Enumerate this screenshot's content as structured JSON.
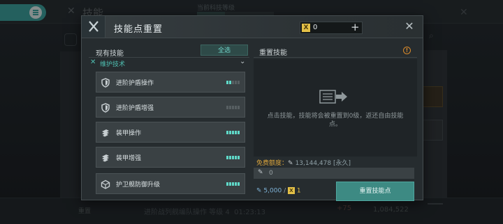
{
  "background": {
    "title": "技能",
    "tech_label": "当前科技等级",
    "bottom_reset": "重置",
    "bottom_text": "进阶战列舰编队操作 等级 4",
    "bottom_timer": "01:23:13",
    "bottom_plus": "+75",
    "bottom_num": "1,084,522"
  },
  "modal": {
    "title": "技能点重置",
    "currency_value": "0",
    "currency_icon": "X",
    "left": {
      "title": "现有技能",
      "all_button": "全选",
      "category": "维护技术",
      "skills": [
        {
          "name": "进阶护盾操作",
          "icon": "shield-icon",
          "level": 2,
          "max": 5
        },
        {
          "name": "进阶护盾增强",
          "icon": "shield-icon",
          "level": 0,
          "max": 5
        },
        {
          "name": "装甲操作",
          "icon": "armor-icon",
          "level": 5,
          "max": 5
        },
        {
          "name": "装甲增强",
          "icon": "armor-icon",
          "level": 5,
          "max": 5
        },
        {
          "name": "护卫舰防御升级",
          "icon": "cube-icon",
          "level": 5,
          "max": 5
        }
      ]
    },
    "right": {
      "title": "重置技能",
      "message": "点击技能，技能将会被重置到0级，返还自由技能点。",
      "free_label": "免费额度：",
      "free_value": "13,144,478 [永久]",
      "input_value": "0",
      "cost_points": "5,000",
      "cost_sep": "/",
      "cost_gold": "1",
      "reset_button": "重置技能点"
    }
  },
  "colors": {
    "accent": "#3d8a83",
    "accent_text": "#5fd9c8",
    "gold": "#e3c047",
    "warning": "#d98a2b"
  }
}
